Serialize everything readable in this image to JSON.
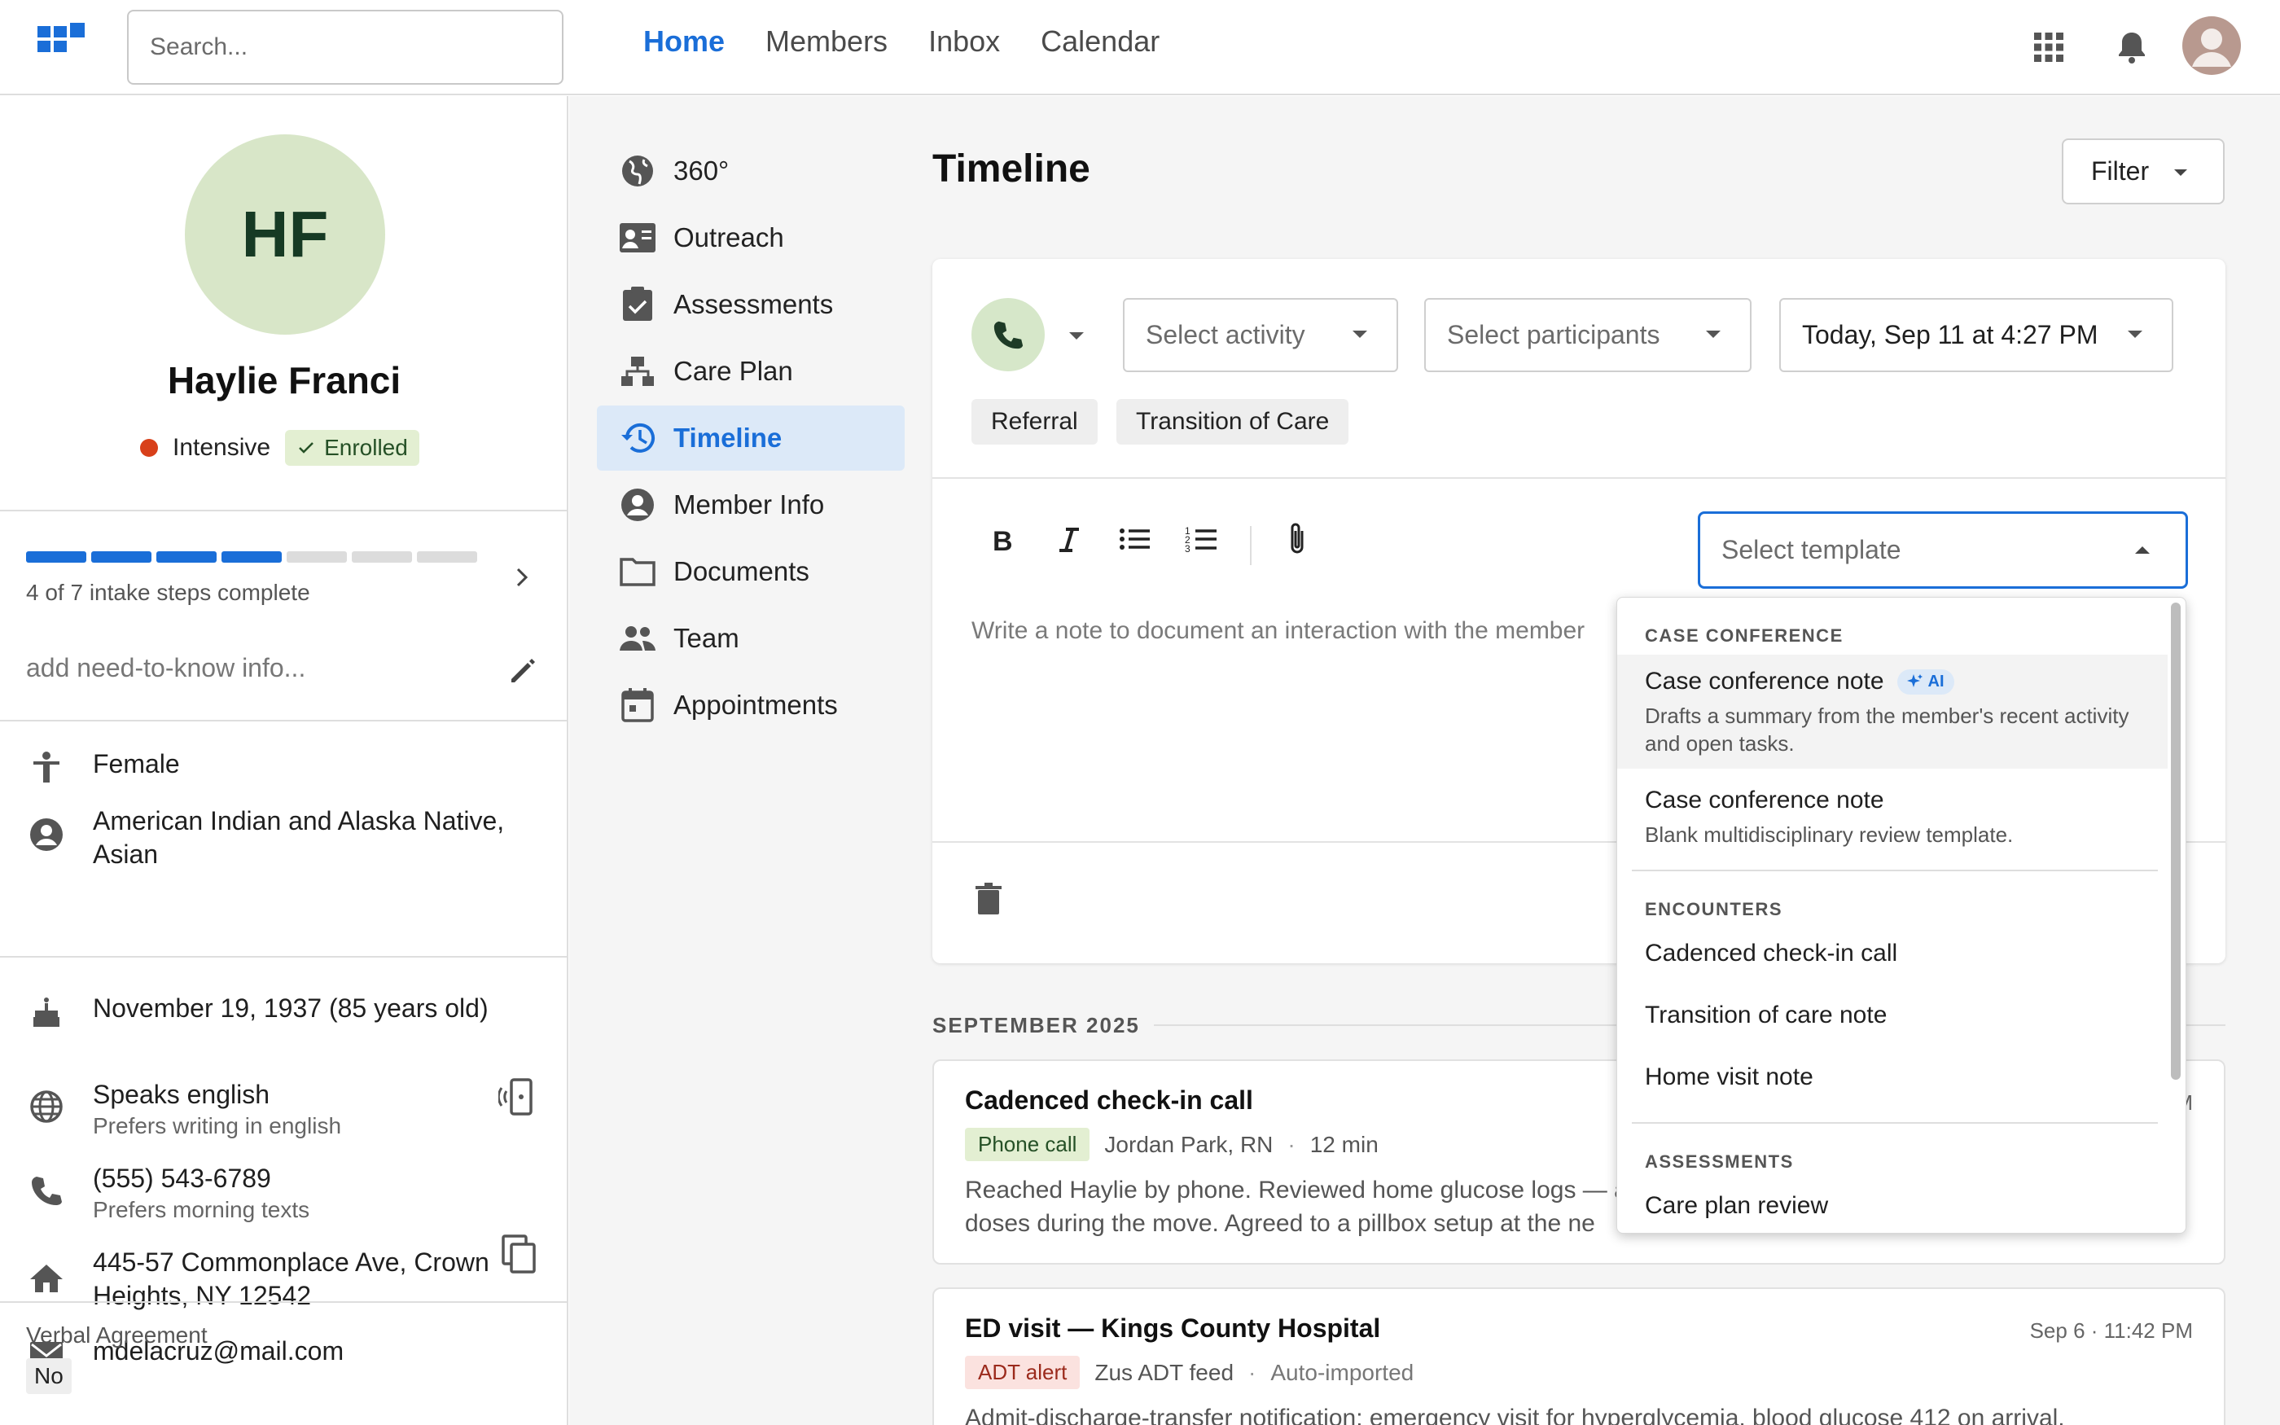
{
  "search": {
    "placeholder": "Search..."
  },
  "nav": [
    {
      "label": "Home",
      "active": true
    },
    {
      "label": "Members"
    },
    {
      "label": "Inbox"
    },
    {
      "label": "Calendar"
    }
  ],
  "top_icons": [
    "apps-grid-icon",
    "bell-icon",
    "user-avatar"
  ],
  "profile": {
    "initials": "HF",
    "name": "Haylie Franci",
    "acuity": "Intensive",
    "status": "Enrolled",
    "intake": {
      "done": 4,
      "total": 7,
      "label": "4 of 7 intake steps complete"
    },
    "need_to_know_placeholder": "add need-to-know info...",
    "gender": "Female",
    "ethnicity": "American Indian and Alaska Native, Asian",
    "dob": "November 19, 1937 (85 years old)",
    "language": "Speaks english",
    "language_sub": "Prefers writing in english",
    "phone": "(555) 543-6789",
    "phone_sub": "Prefers morning texts",
    "address": "445-57 Commonplace Ave, Crown Heights, NY 12542",
    "email": "mdelacruz@mail.com",
    "verbal_label": "Verbal Agreement",
    "verbal_value": "No"
  },
  "subnav": [
    {
      "label": "360°",
      "icon": "globe-icon"
    },
    {
      "label": "Outreach",
      "icon": "contact-card-icon"
    },
    {
      "label": "Assessments",
      "icon": "clipboard-check-icon"
    },
    {
      "label": "Care Plan",
      "icon": "hierarchy-icon"
    },
    {
      "label": "Timeline",
      "icon": "history-icon",
      "active": true
    },
    {
      "label": "Member Info",
      "icon": "account-circle-icon"
    },
    {
      "label": "Documents",
      "icon": "folder-icon"
    },
    {
      "label": "Team",
      "icon": "people-icon"
    },
    {
      "label": "Appointments",
      "icon": "calendar-icon"
    }
  ],
  "main": {
    "title": "Timeline",
    "filter": "Filter",
    "composer": {
      "activity_placeholder": "Select activity",
      "participants_placeholder": "Select participants",
      "datetime": "Today, Sep 11 at 4:27 PM",
      "chips": [
        "Referral",
        "Transition of Care"
      ],
      "template_placeholder": "Select template",
      "note_placeholder": "Write a note to document an interaction with the member"
    },
    "month": "SEPTEMBER 2025",
    "cards": [
      {
        "title": "Cadenced check-in call",
        "type": "Phone call",
        "author": "Jordan Park, RN",
        "duration": "12 min",
        "when": "M",
        "body_1": "Reached Haylie by phone. Reviewed home glucose logs — a",
        "body_2": "doses during the move. Agreed to a pillbox setup at the ne"
      },
      {
        "title": "ED visit — Kings County Hospital",
        "type": "ADT alert",
        "author": "Zus ADT feed",
        "duration": "Auto-imported",
        "when": "Sep 6 · 11:42 PM",
        "body_1": "Admit-discharge-transfer notification: emergency visit for hyperglycemia, blood glucose 412 on arrival."
      }
    ]
  },
  "template_dropdown": {
    "sections": [
      {
        "header": "CASE CONFERENCE",
        "items": [
          {
            "title": "Case conference note",
            "ai": "AI",
            "desc": "Drafts a summary from the member's recent activity and open tasks.",
            "highlighted": true
          },
          {
            "title": "Case conference note",
            "desc": "Blank multidisciplinary review template."
          }
        ]
      },
      {
        "header": "ENCOUNTERS",
        "items": [
          {
            "title": "Cadenced check-in call"
          },
          {
            "title": "Transition of care note"
          },
          {
            "title": "Home visit note"
          }
        ]
      },
      {
        "header": "ASSESSMENTS",
        "items": [
          {
            "title": "Care plan review"
          }
        ]
      }
    ]
  },
  "colors": {
    "accent": "#1a6ed8",
    "enrolled_bg": "#e3efd2",
    "alert_bg": "#fbe2df",
    "avatar_bg": "#d8e6c8",
    "acuity_dot": "#d8401a"
  }
}
